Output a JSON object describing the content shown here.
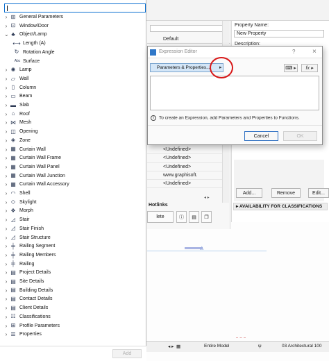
{
  "left_panel": {
    "search_value": "",
    "items": [
      {
        "label": "General Parameters",
        "icon": "general-params-icon",
        "glyph": "⊞",
        "expanded": false
      },
      {
        "label": "Window/Door",
        "icon": "window-door-icon",
        "glyph": "⊡",
        "expanded": false
      },
      {
        "label": "Object/Lamp",
        "icon": "object-lamp-icon",
        "glyph": "♣",
        "expanded": true
      },
      {
        "label": "Length (A)",
        "icon": "length-icon",
        "glyph": "⟷",
        "child": true
      },
      {
        "label": "Rotation Angle",
        "icon": "rotation-icon",
        "glyph": "↻",
        "child": true
      },
      {
        "label": "Surface",
        "icon": "surface-icon",
        "glyph": "Abc",
        "child": true
      },
      {
        "label": "Lamp",
        "icon": "lamp-icon",
        "glyph": "✺",
        "expanded": false
      },
      {
        "label": "Wall",
        "icon": "wall-icon",
        "glyph": "▱",
        "expanded": false
      },
      {
        "label": "Column",
        "icon": "column-icon",
        "glyph": "▯",
        "expanded": false
      },
      {
        "label": "Beam",
        "icon": "beam-icon",
        "glyph": "▭",
        "expanded": false
      },
      {
        "label": "Slab",
        "icon": "slab-icon",
        "glyph": "▬",
        "expanded": false
      },
      {
        "label": "Roof",
        "icon": "roof-icon",
        "glyph": "⌂",
        "expanded": false
      },
      {
        "label": "Mesh",
        "icon": "mesh-icon",
        "glyph": "⋈",
        "expanded": false
      },
      {
        "label": "Opening",
        "icon": "opening-icon",
        "glyph": "◫",
        "expanded": false
      },
      {
        "label": "Zone",
        "icon": "zone-icon",
        "glyph": "◈",
        "expanded": false
      },
      {
        "label": "Curtain Wall",
        "icon": "curtain-wall-icon",
        "glyph": "▦",
        "expanded": false
      },
      {
        "label": "Curtain Wall Frame",
        "icon": "cw-frame-icon",
        "glyph": "▦",
        "expanded": false
      },
      {
        "label": "Curtain Wall Panel",
        "icon": "cw-panel-icon",
        "glyph": "▦",
        "expanded": false
      },
      {
        "label": "Curtain Wall Junction",
        "icon": "cw-junction-icon",
        "glyph": "▦",
        "expanded": false
      },
      {
        "label": "Curtain Wall Accessory",
        "icon": "cw-accessory-icon",
        "glyph": "▦",
        "expanded": false
      },
      {
        "label": "Shell",
        "icon": "shell-icon",
        "glyph": "◠",
        "expanded": false
      },
      {
        "label": "Skylight",
        "icon": "skylight-icon",
        "glyph": "◇",
        "expanded": false
      },
      {
        "label": "Morph",
        "icon": "morph-icon",
        "glyph": "❖",
        "expanded": false
      },
      {
        "label": "Stair",
        "icon": "stair-icon",
        "glyph": "◿",
        "expanded": false
      },
      {
        "label": "Stair Finish",
        "icon": "stair-finish-icon",
        "glyph": "◿",
        "expanded": false
      },
      {
        "label": "Stair Structure",
        "icon": "stair-structure-icon",
        "glyph": "◿",
        "expanded": false
      },
      {
        "label": "Railing Segment",
        "icon": "railing-segment-icon",
        "glyph": "╪",
        "expanded": false
      },
      {
        "label": "Railing Members",
        "icon": "railing-members-icon",
        "glyph": "╪",
        "expanded": false
      },
      {
        "label": "Railing",
        "icon": "railing-icon",
        "glyph": "╪",
        "expanded": false
      },
      {
        "label": "Project Details",
        "icon": "project-details-icon",
        "glyph": "▤",
        "expanded": false
      },
      {
        "label": "Site Details",
        "icon": "site-details-icon",
        "glyph": "▤",
        "expanded": false
      },
      {
        "label": "Building Details",
        "icon": "building-details-icon",
        "glyph": "▤",
        "expanded": false
      },
      {
        "label": "Contact Details",
        "icon": "contact-details-icon",
        "glyph": "▤",
        "expanded": false
      },
      {
        "label": "Client Details",
        "icon": "client-details-icon",
        "glyph": "▤",
        "expanded": false
      },
      {
        "label": "Classifications",
        "icon": "classifications-icon",
        "glyph": "☷",
        "expanded": false
      },
      {
        "label": "Profile Parameters",
        "icon": "profile-params-icon",
        "glyph": "⊞",
        "expanded": false
      },
      {
        "label": "Properties",
        "icon": "properties-icon",
        "glyph": "☰",
        "expanded": false
      }
    ],
    "add_label": "Add"
  },
  "dialog": {
    "title": "Expression Editor",
    "help_glyph": "?",
    "close_glyph": "×",
    "params_button_label": "Parameters & Properties...",
    "params_arrow": "▸",
    "keyboard_glyph": "⌨ ▸",
    "fx_glyph": "fx ▸",
    "info_text": "To create an Expression, add Parameters and Properties to Functions.",
    "cancel_label": "Cancel",
    "ok_label": "OK"
  },
  "background": {
    "default_label": "Default",
    "values": [
      "<Undefined>",
      "<Undefined>",
      "<Undefined>",
      "www.graphisoft.",
      "<Undefined>"
    ],
    "hotlinks_label": "Hotlinks",
    "delete_label": "lete",
    "property_name_label": "Property Name:",
    "property_name_value": "New Property",
    "description_label": "Description:",
    "add_label": "Add...",
    "remove_label": "Remove",
    "edit_label": "Edit...",
    "availability_label": "AVAILABILITY FOR CLASSIFICATIONS",
    "status_model": "Entire Model",
    "status_layer": "03 Architectural 100"
  },
  "colors": {
    "accent_blue": "#0b6fd0",
    "highlight_circle": "#d81818",
    "selected_button": "#d4e6f7"
  }
}
